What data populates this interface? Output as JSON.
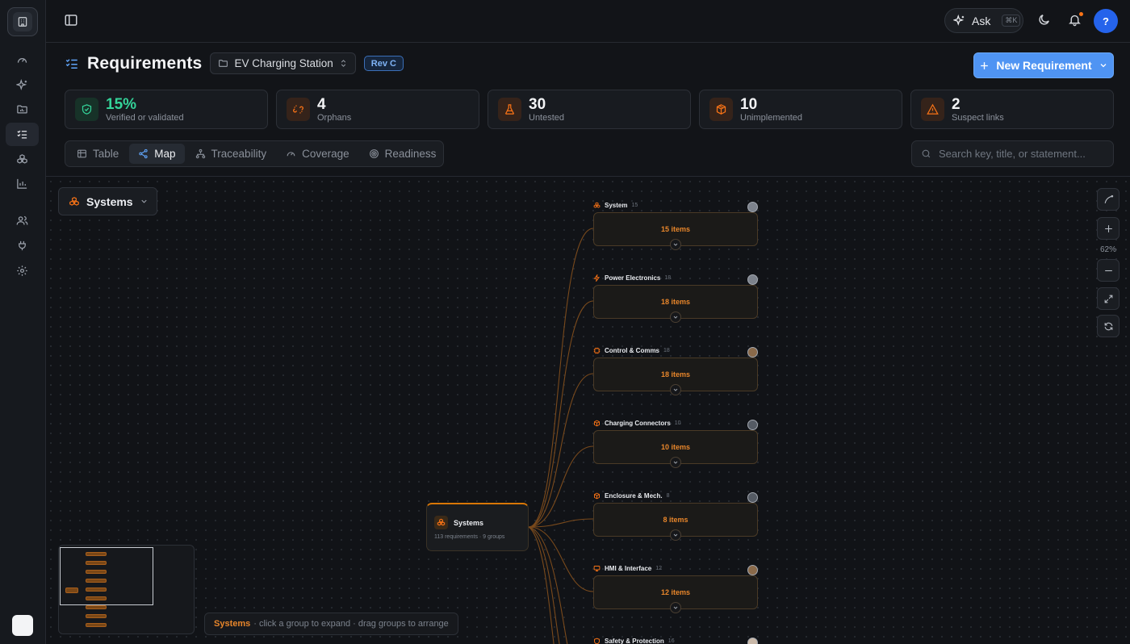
{
  "topbar": {
    "ask_label": "Ask",
    "ask_shortcut": "⌘K",
    "avatar_initial": "?"
  },
  "page": {
    "title": "Requirements",
    "project": "EV Charging Station",
    "revision": "Rev C",
    "new_button": "New Requirement"
  },
  "stats": [
    {
      "value": "15%",
      "label": "Verified or validated",
      "icon": "shield-check-icon",
      "color": "#34d399"
    },
    {
      "value": "4",
      "label": "Orphans",
      "icon": "unlink-icon",
      "color": "#f97316"
    },
    {
      "value": "30",
      "label": "Untested",
      "icon": "flask-icon",
      "color": "#f97316"
    },
    {
      "value": "10",
      "label": "Unimplemented",
      "icon": "package-icon",
      "color": "#f97316"
    },
    {
      "value": "2",
      "label": "Suspect links",
      "icon": "warning-icon",
      "color": "#f97316"
    }
  ],
  "tabs": [
    {
      "label": "Table",
      "icon": "table-icon",
      "active": false
    },
    {
      "label": "Map",
      "icon": "share-icon",
      "active": true
    },
    {
      "label": "Traceability",
      "icon": "hierarchy-icon",
      "active": false
    },
    {
      "label": "Coverage",
      "icon": "gauge-icon",
      "active": false
    },
    {
      "label": "Readiness",
      "icon": "target-icon",
      "active": false
    }
  ],
  "search": {
    "placeholder": "Search key, title, or statement..."
  },
  "map": {
    "grouping": "Systems",
    "zoom": "62%",
    "root": {
      "title": "Systems",
      "subtitle": "113 requirements · 9 groups"
    },
    "groups": [
      {
        "name": "System",
        "count": "15",
        "items": "15 items",
        "icon": "systems-icon"
      },
      {
        "name": "Power Electronics",
        "count": "18",
        "items": "18 items",
        "icon": "bolt-icon"
      },
      {
        "name": "Control & Comms",
        "count": "18",
        "items": "18 items",
        "icon": "chip-icon"
      },
      {
        "name": "Charging Connectors",
        "count": "10",
        "items": "10 items",
        "icon": "package-icon"
      },
      {
        "name": "Enclosure & Mech.",
        "count": "8",
        "items": "8 items",
        "icon": "package-icon"
      },
      {
        "name": "HMI & Interface",
        "count": "12",
        "items": "12 items",
        "icon": "monitor-icon"
      },
      {
        "name": "Safety & Protection",
        "count": "16",
        "items": "",
        "icon": "shield-icon"
      }
    ],
    "hint": {
      "strong": "Systems",
      "text": "· click a group to expand · drag groups to arrange"
    }
  },
  "colors": {
    "accent": "#4f94f3",
    "map_orange": "#e8862b",
    "verified_green": "#34d399"
  }
}
